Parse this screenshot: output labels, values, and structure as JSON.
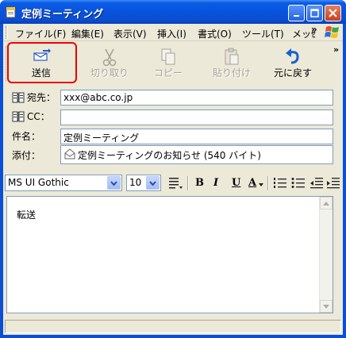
{
  "window": {
    "title": "定例ミーティング"
  },
  "menu": {
    "items": [
      "ファイル(F)",
      "編集(E)",
      "表示(V)",
      "挿入(I)",
      "書式(O)",
      "ツール(T)",
      "メッｾ"
    ],
    "overflow": "»"
  },
  "toolbar": {
    "send": "送信",
    "cut": "切り取り",
    "copy": "コピー",
    "paste": "貼り付け",
    "undo": "元に戻す",
    "overflow": "»"
  },
  "headers": {
    "to_label": "宛先：",
    "to_value": "xxx@abc.co.jp",
    "cc_label": "CC：",
    "cc_value": "",
    "subject_label": "件名：",
    "subject_value": "定例ミーティング",
    "attach_label": "添付：",
    "attach_value": "定例ミーティングのお知らせ (540 バイト)"
  },
  "format": {
    "font": "MS UI Gothic",
    "size": "10",
    "bold": "B",
    "italic": "I",
    "underline": "U",
    "color": "A"
  },
  "body": {
    "text": "転送"
  },
  "colors": {
    "accent": "#0a4fd4",
    "highlight": "#e00000",
    "undo_icon": "#1a5fd0"
  }
}
